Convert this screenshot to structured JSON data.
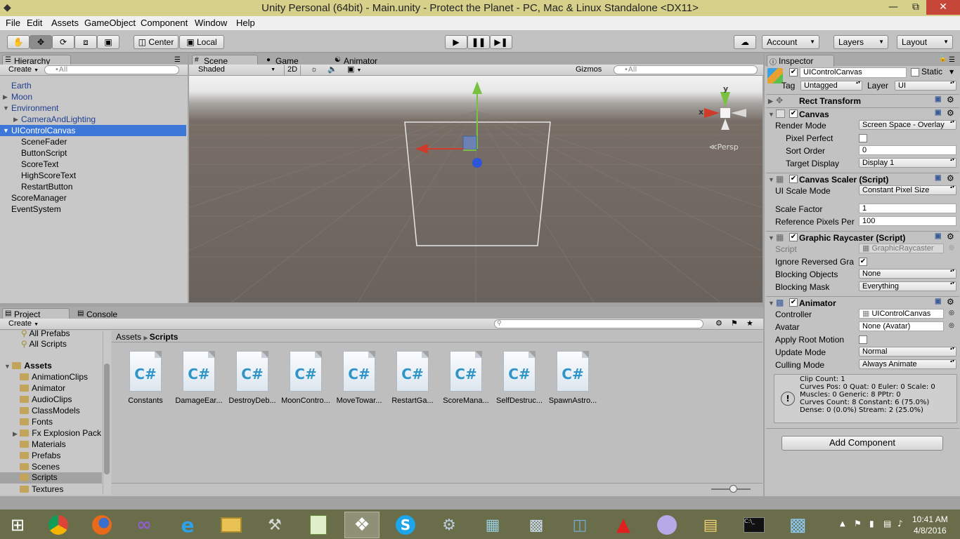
{
  "window": {
    "title": "Unity Personal (64bit) - Main.unity - Protect the Planet - PC, Mac & Linux Standalone <DX11>"
  },
  "menu": [
    "File",
    "Edit",
    "Assets",
    "GameObject",
    "Component",
    "Window",
    "Help"
  ],
  "toolbar": {
    "center": "Center",
    "local": "Local",
    "account": "Account",
    "layers": "Layers",
    "layout": "Layout"
  },
  "hierarchy": {
    "tab": "Hierarchy",
    "create": "Create",
    "search_placeholder": "•All",
    "items": [
      {
        "label": "Earth"
      },
      {
        "label": "Moon"
      },
      {
        "label": "Environment"
      },
      {
        "label": "CameraAndLighting"
      },
      {
        "label": "UIControlCanvas"
      },
      {
        "label": "SceneFader"
      },
      {
        "label": "ButtonScript"
      },
      {
        "label": "ScoreText"
      },
      {
        "label": "HighScoreText"
      },
      {
        "label": "RestartButton"
      },
      {
        "label": "ScoreManager"
      },
      {
        "label": "EventSystem"
      }
    ]
  },
  "scene": {
    "tabs": [
      "Scene",
      "Game",
      "Animator"
    ],
    "shading": "Shaded",
    "mode2d": "2D",
    "gizmos": "Gizmos",
    "search_placeholder": "•All",
    "gizmo_x": "x",
    "gizmo_y": "y",
    "persp": "Persp"
  },
  "project": {
    "tabs": [
      "Project",
      "Console"
    ],
    "create": "Create",
    "favorites": [
      "All Prefabs",
      "All Scripts"
    ],
    "root": "Assets",
    "folders": [
      "AnimationClips",
      "Animator",
      "AudioClips",
      "ClassModels",
      "Fonts",
      "Fx Explosion Pack",
      "Materials",
      "Prefabs",
      "Scenes",
      "Scripts",
      "Textures"
    ],
    "breadcrumb": [
      "Assets",
      "Scripts"
    ],
    "assets": [
      "Constants",
      "DamageEar...",
      "DestroyDeb...",
      "MoonContro...",
      "MoveTowar...",
      "RestartGa...",
      "ScoreMana...",
      "SelfDestruc...",
      "SpawnAstro..."
    ],
    "asset_icon_text": "C#"
  },
  "inspector": {
    "tab": "Inspector",
    "object_name": "UIControlCanvas",
    "static": "Static",
    "tag_label": "Tag",
    "tag_value": "Untagged",
    "layer_label": "Layer",
    "layer_value": "UI",
    "rect_transform": "Rect Transform",
    "canvas": {
      "title": "Canvas",
      "render_mode_label": "Render Mode",
      "render_mode": "Screen Space - Overlay",
      "pixel_perfect_label": "Pixel Perfect",
      "sort_order_label": "Sort Order",
      "sort_order": "0",
      "target_display_label": "Target Display",
      "target_display": "Display 1"
    },
    "scaler": {
      "title": "Canvas Scaler (Script)",
      "ui_scale_mode_label": "UI Scale Mode",
      "ui_scale_mode": "Constant Pixel Size",
      "scale_factor_label": "Scale Factor",
      "scale_factor": "1",
      "ref_pixels_label": "Reference Pixels Per",
      "ref_pixels": "100"
    },
    "raycaster": {
      "title": "Graphic Raycaster (Script)",
      "script_label": "Script",
      "script": "GraphicRaycaster",
      "ignore_label": "Ignore Reversed Gra",
      "blocking_objects_label": "Blocking Objects",
      "blocking_objects": "None",
      "blocking_mask_label": "Blocking Mask",
      "blocking_mask": "Everything"
    },
    "animator": {
      "title": "Animator",
      "controller_label": "Controller",
      "controller": "UIControlCanvas",
      "avatar_label": "Avatar",
      "avatar": "None (Avatar)",
      "apply_root_label": "Apply Root Motion",
      "update_mode_label": "Update Mode",
      "update_mode": "Normal",
      "culling_mode_label": "Culling Mode",
      "culling_mode": "Always Animate",
      "info": [
        "Clip Count: 1",
        "Curves Pos: 0 Quat: 0 Euler: 0 Scale: 0",
        "Muscles: 0 Generic: 8 PPtr: 0",
        "Curves Count: 8 Constant: 6 (75.0%)",
        "Dense: 0 (0.0%) Stream: 2 (25.0%)"
      ]
    },
    "add_component": "Add Component"
  },
  "taskbar": {
    "time": "10:41 AM",
    "date": "4/8/2016"
  },
  "colors": {
    "title_bar": "#d7d08b",
    "selection": "#3d78d8",
    "panel": "#c2c2c2",
    "taskbar": "#6a6d4a"
  }
}
